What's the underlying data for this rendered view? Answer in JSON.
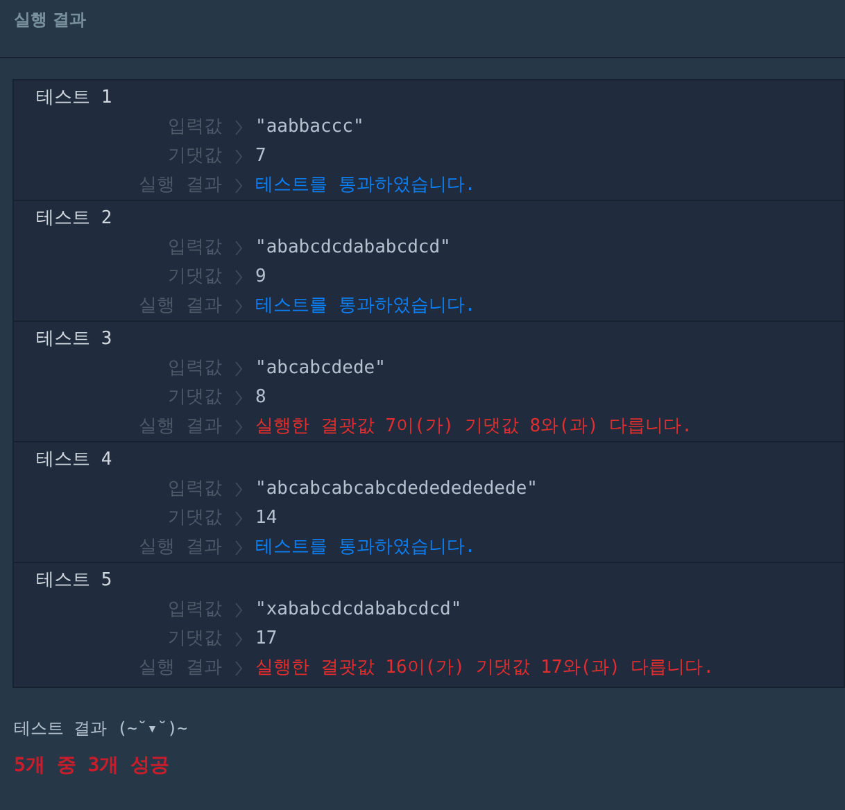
{
  "header": {
    "title": "실행 결과"
  },
  "tests": [
    {
      "title": "테스트 1",
      "rows": [
        {
          "label": "입력값",
          "value": "\"aabbaccc\""
        },
        {
          "label": "기댓값",
          "value": "7"
        }
      ],
      "result_label": "실행 결과",
      "result": "테스트를 통과하였습니다.",
      "passed": true
    },
    {
      "title": "테스트 2",
      "rows": [
        {
          "label": "입력값",
          "value": "\"ababcdcdababcdcd\""
        },
        {
          "label": "기댓값",
          "value": "9"
        }
      ],
      "result_label": "실행 결과",
      "result": "테스트를 통과하였습니다.",
      "passed": true
    },
    {
      "title": "테스트 3",
      "rows": [
        {
          "label": "입력값",
          "value": "\"abcabcdede\""
        },
        {
          "label": "기댓값",
          "value": "8"
        }
      ],
      "result_label": "실행 결과",
      "result": "실행한 결괏값 7이(가) 기댓값 8와(과) 다릅니다.",
      "passed": false
    },
    {
      "title": "테스트 4",
      "rows": [
        {
          "label": "입력값",
          "value": "\"abcabcabcabcdededededede\""
        },
        {
          "label": "기댓값",
          "value": "14"
        }
      ],
      "result_label": "실행 결과",
      "result": "테스트를 통과하였습니다.",
      "passed": true
    },
    {
      "title": "테스트 5",
      "rows": [
        {
          "label": "입력값",
          "value": "\"xababcdcdababcdcd\""
        },
        {
          "label": "기댓값",
          "value": "17"
        }
      ],
      "result_label": "실행 결과",
      "result": "실행한 결괏값 16이(가) 기댓값 17와(과) 다릅니다.",
      "passed": false
    }
  ],
  "summary": {
    "caption": "테스트 결과 (~˘▾˘)~",
    "score": "5개 중 3개 성공"
  }
}
